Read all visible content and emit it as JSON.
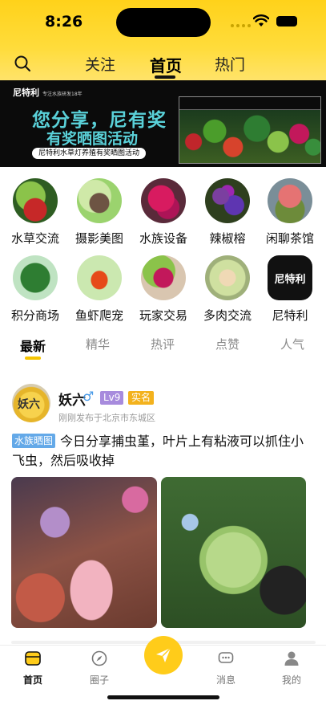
{
  "status_bar": {
    "time": "8:26"
  },
  "nav": {
    "tabs": [
      {
        "label": "关注"
      },
      {
        "label": "首页"
      },
      {
        "label": "热门"
      }
    ]
  },
  "banner": {
    "brand": "尼特利",
    "brand_sub": "专注水族研发18年",
    "headline": "您分享，尼有奖",
    "subheadline": "有奖晒图活动",
    "pill": "尼特利水草灯养殖有奖晒图活动"
  },
  "categories": [
    {
      "label": "水草交流"
    },
    {
      "label": "摄影美图"
    },
    {
      "label": "水族设备"
    },
    {
      "label": "辣椒榕"
    },
    {
      "label": "闲聊茶馆"
    },
    {
      "label": "积分商场"
    },
    {
      "label": "鱼虾爬宠"
    },
    {
      "label": "玩家交易"
    },
    {
      "label": "多肉交流"
    },
    {
      "label": "尼特利"
    }
  ],
  "category_logo_text": "尼特利",
  "sub_tabs": [
    {
      "label": "最新"
    },
    {
      "label": "精华"
    },
    {
      "label": "热评"
    },
    {
      "label": "点赞"
    },
    {
      "label": "人气"
    }
  ],
  "post": {
    "user_name": "妖六",
    "gender": "♂",
    "level": "Lv9",
    "badge": "实名",
    "meta": "刚刚发布于北京市东城区",
    "tag": "水族晒图",
    "text": "今日分享捕虫堇，叶片上有粘液可以抓住小飞虫，然后吸收掉",
    "avatar_text": "妖六"
  },
  "bottom_nav": {
    "items": [
      {
        "label": "首页"
      },
      {
        "label": "圈子"
      },
      {
        "label": "消息"
      },
      {
        "label": "我的"
      }
    ]
  },
  "colors": {
    "accent": "#ffcc1a",
    "header": "#ffd21a",
    "tag_blue": "#64a9e8",
    "level_purple": "#a78bdd"
  }
}
